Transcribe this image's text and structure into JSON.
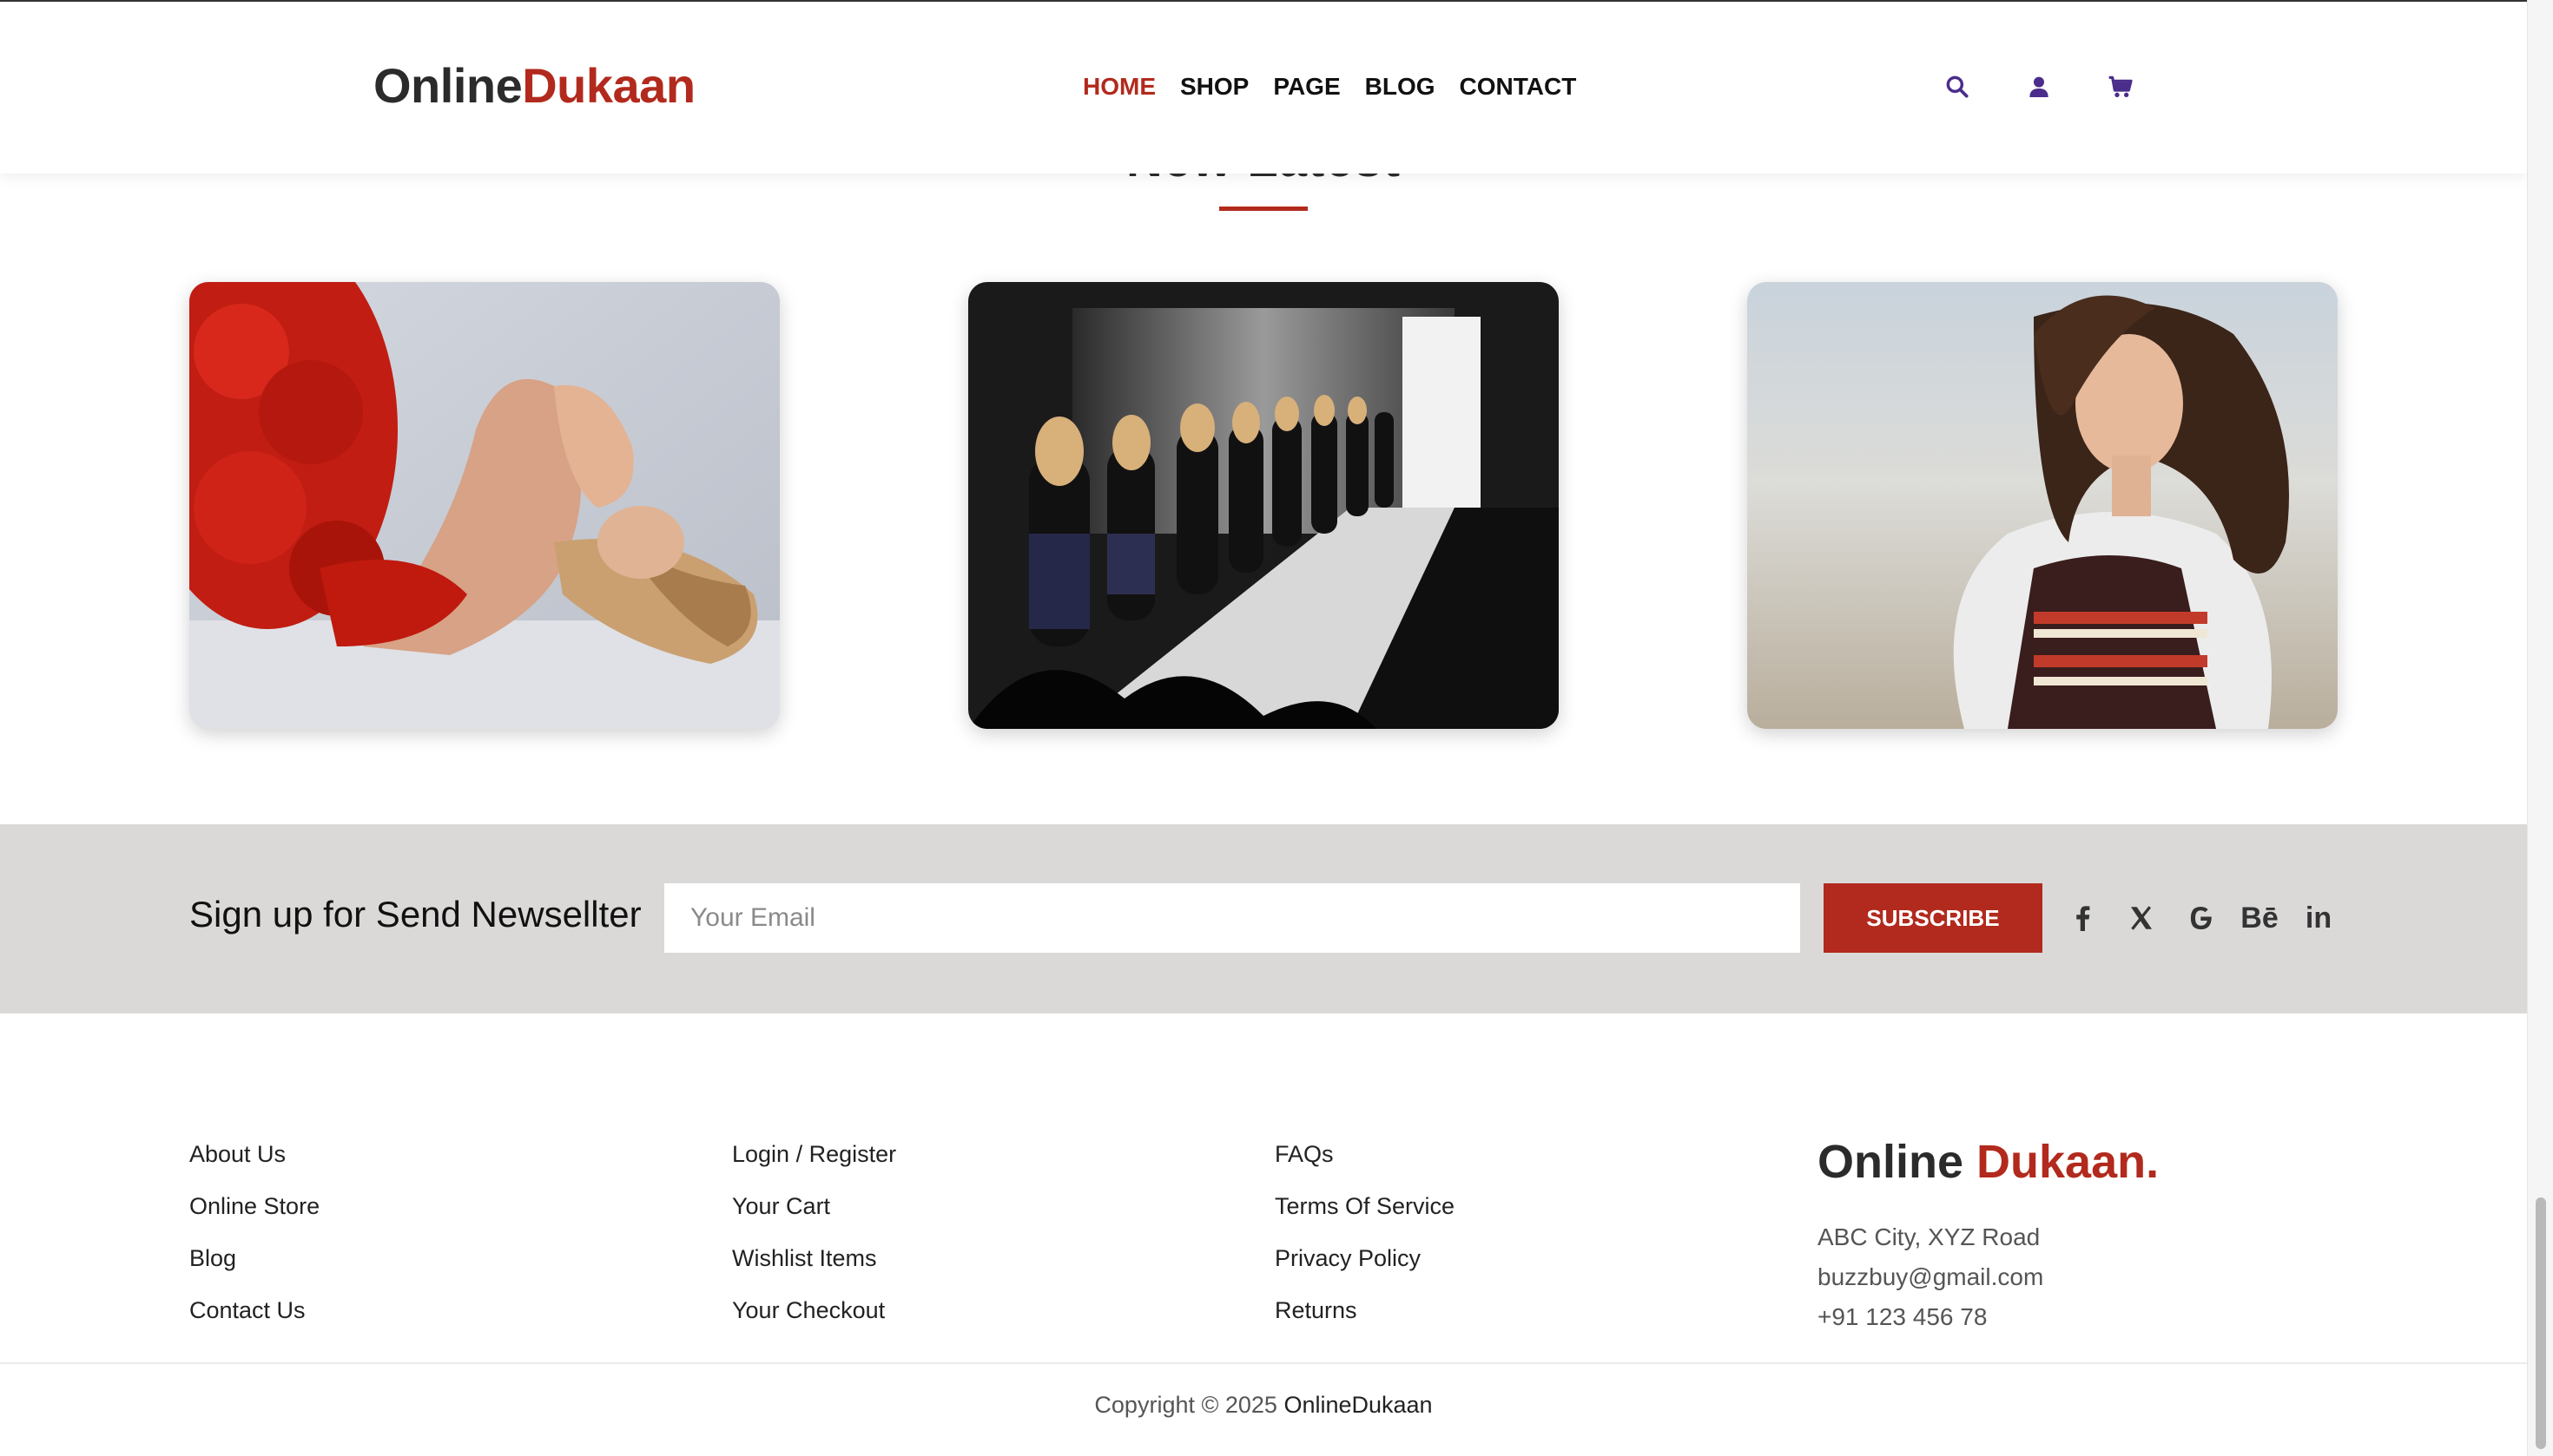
{
  "header": {
    "logo_part1": "Online",
    "logo_part2": "Dukaan",
    "nav": [
      "HOME",
      "SHOP",
      "PAGE",
      "BLOG",
      "CONTACT"
    ],
    "active_nav": "HOME",
    "icons": [
      "search-icon",
      "user-icon",
      "cart-icon"
    ]
  },
  "section": {
    "heading": "New Latest",
    "cards": [
      {
        "image": "woman lying on red roses in red dress"
      },
      {
        "image": "fashion runway with models walking"
      },
      {
        "image": "woman with curly hair in white cardigan on beach"
      }
    ]
  },
  "newsletter": {
    "title": "Sign up for Send Newsellter",
    "input_placeholder": "Your Email",
    "button_label": "SUBSCRIBE",
    "social": [
      "facebook-icon",
      "x-icon",
      "google-icon",
      "behance-icon",
      "linkedin-icon"
    ],
    "behance_text": "Bē",
    "linkedin_text": "in"
  },
  "footer": {
    "col1": [
      "About Us",
      "Online Store",
      "Blog",
      "Contact Us"
    ],
    "col2": [
      "Login / Register",
      "Your Cart",
      "Wishlist Items",
      "Your Checkout"
    ],
    "col3": [
      "FAQs",
      "Terms Of Service",
      "Privacy Policy",
      "Returns"
    ],
    "brand_part1": "Online",
    "brand_part2": "Dukaan.",
    "address": "ABC City, XYZ Road",
    "email": "buzzbuy@gmail.com",
    "phone": "+91 123 456 78",
    "copyright_prefix": "Copyright © 2025",
    "copyright_brand": "OnlineDukaan"
  },
  "colors": {
    "accent": "#b22a1d",
    "newsletter_bg": "#dad9d8"
  }
}
